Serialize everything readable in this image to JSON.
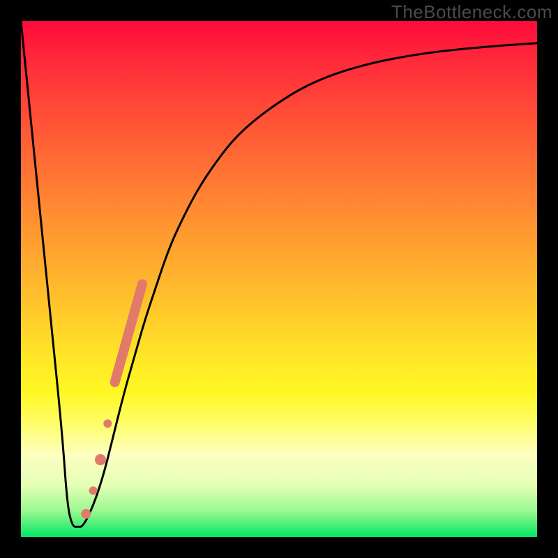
{
  "watermark": "TheBottleneck.com",
  "colors": {
    "page_bg": "#000000",
    "curve": "#000000",
    "marker_fill": "#e17a6b",
    "marker_stroke": "#d65f50",
    "gradient_top": "#ff0a3a",
    "gradient_bottom": "#00e765"
  },
  "chart_data": {
    "type": "line",
    "title": "",
    "xlabel": "",
    "ylabel": "",
    "xlim": [
      0,
      100
    ],
    "ylim": [
      0,
      100
    ],
    "grid": false,
    "legend": null,
    "series": [
      {
        "name": "bottleneck-curve",
        "x": [
          0,
          2,
          4,
          6,
          8,
          9,
          10,
          11,
          12,
          14,
          16,
          18,
          20,
          22,
          24,
          26,
          28,
          30,
          34,
          38,
          42,
          48,
          56,
          66,
          78,
          90,
          100
        ],
        "y": [
          100,
          80,
          60,
          40,
          20,
          6,
          2,
          2,
          2,
          6,
          12,
          20,
          28,
          35,
          42,
          48,
          54,
          59,
          67,
          73,
          78,
          83,
          88,
          91.5,
          93.8,
          95,
          95.7
        ]
      }
    ],
    "markers": [
      {
        "series": "highlight-segment",
        "type": "segment",
        "x0": 18.2,
        "y0": 30.0,
        "x1": 23.5,
        "y1": 49.0,
        "width": 14
      },
      {
        "series": "highlight-dot",
        "type": "dot",
        "x": 16.8,
        "y": 22.0,
        "r": 6
      },
      {
        "series": "highlight-dot",
        "type": "dot",
        "x": 15.4,
        "y": 15.0,
        "r": 8
      },
      {
        "series": "highlight-dot",
        "type": "dot",
        "x": 14.0,
        "y": 9.0,
        "r": 6
      },
      {
        "series": "highlight-dot",
        "type": "dot",
        "x": 12.6,
        "y": 4.5,
        "r": 7
      }
    ],
    "annotations": []
  }
}
